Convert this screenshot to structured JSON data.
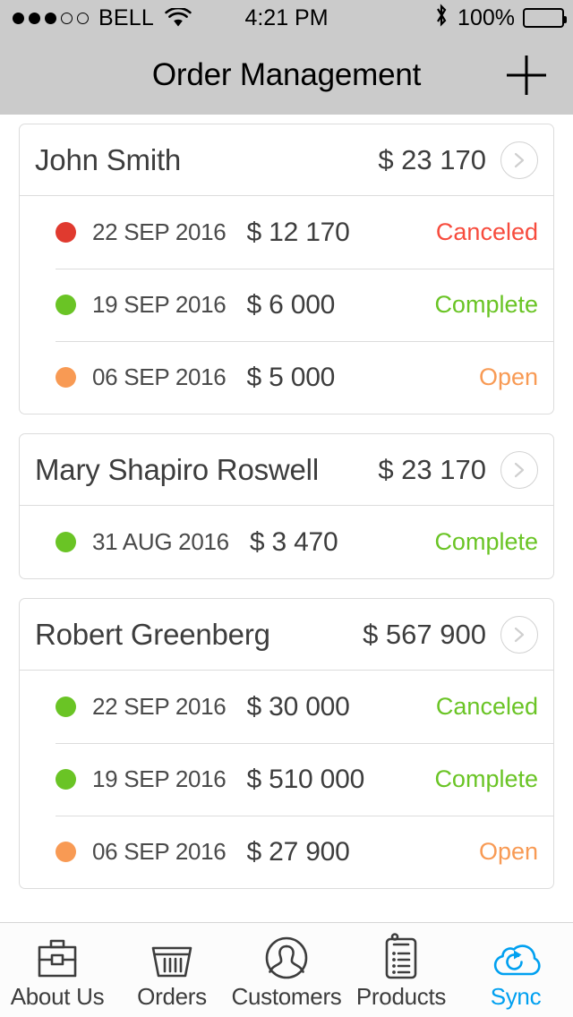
{
  "status_bar": {
    "signal_dots_filled": 3,
    "signal_dots_total": 5,
    "carrier": "BELL",
    "wifi_icon": "wifi-icon",
    "time": "4:21 PM",
    "bluetooth_icon": "bluetooth-icon",
    "battery_percent": "100%",
    "battery_level": 100
  },
  "navbar": {
    "title": "Order Management",
    "add_icon": "plus-icon"
  },
  "colors": {
    "status_canceled": "#f74b3d",
    "status_complete": "#6ac425",
    "status_open": "#f89a54",
    "dot_red": "#e03a2f",
    "dot_green": "#6ac425",
    "dot_orange": "#f89a54",
    "accent": "#00a0f0",
    "text": "#3d3d3d",
    "border": "#dcdcdc",
    "chrome": "#cbcbcb"
  },
  "customers": [
    {
      "name": "John Smith",
      "total": "$ 23 170",
      "chevron_icon": "chevron-right-icon",
      "orders": [
        {
          "dot_color": "#e03a2f",
          "date": "22 SEP 2016",
          "amount": "$ 12 170",
          "status": "Canceled",
          "status_color": "#f74b3d"
        },
        {
          "dot_color": "#6ac425",
          "date": "19 SEP 2016",
          "amount": "$ 6 000",
          "status": "Complete",
          "status_color": "#6ac425"
        },
        {
          "dot_color": "#f89a54",
          "date": "06 SEP 2016",
          "amount": "$ 5 000",
          "status": "Open",
          "status_color": "#f89a54"
        }
      ]
    },
    {
      "name": "Mary Shapiro Roswell",
      "total": "$ 23 170",
      "chevron_icon": "chevron-right-icon",
      "orders": [
        {
          "dot_color": "#6ac425",
          "date": "31 AUG 2016",
          "amount": "$ 3 470",
          "status": "Complete",
          "status_color": "#6ac425"
        }
      ]
    },
    {
      "name": "Robert Greenberg",
      "total": "$ 567 900",
      "chevron_icon": "chevron-right-icon",
      "orders": [
        {
          "dot_color": "#6ac425",
          "date": "22 SEP 2016",
          "amount": "$ 30 000",
          "status": "Canceled",
          "status_color": "#6ac425"
        },
        {
          "dot_color": "#6ac425",
          "date": "19 SEP 2016",
          "amount": "$ 510 000",
          "status": "Complete",
          "status_color": "#6ac425"
        },
        {
          "dot_color": "#f89a54",
          "date": "06 SEP 2016",
          "amount": "$ 27 900",
          "status": "Open",
          "status_color": "#f89a54"
        }
      ]
    }
  ],
  "tabbar": {
    "active_index": 4,
    "tabs": [
      {
        "label": "About Us",
        "icon": "briefcase-icon"
      },
      {
        "label": "Orders",
        "icon": "basket-icon"
      },
      {
        "label": "Customers",
        "icon": "person-circle-icon"
      },
      {
        "label": "Products",
        "icon": "clipboard-list-icon"
      },
      {
        "label": "Sync",
        "icon": "cloud-sync-icon"
      }
    ]
  }
}
